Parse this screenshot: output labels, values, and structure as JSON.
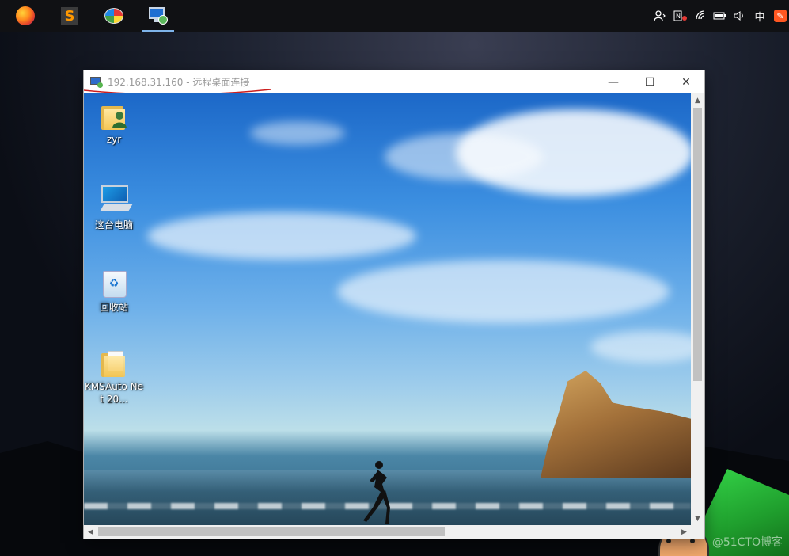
{
  "taskbar": {
    "apps": [
      {
        "name": "firefox-icon"
      },
      {
        "name": "sublime-text-icon"
      },
      {
        "name": "paint-icon"
      },
      {
        "name": "remote-desktop-icon",
        "active": true
      }
    ],
    "tray": {
      "ime_label": "中",
      "accent_color": "#7eb4ea"
    }
  },
  "window": {
    "title": "192.168.31.160 - 远程桌面连接",
    "buttons": {
      "minimize": "—",
      "maximize": "☐",
      "close": "✕"
    },
    "underline_color": "#cc1f1f"
  },
  "remote_desktop": {
    "icons": [
      {
        "label": "zyr",
        "icon": "user-folder-icon"
      },
      {
        "label": "这台电脑",
        "icon": "this-pc-icon"
      },
      {
        "label": "回收站",
        "icon": "recycle-bin-icon"
      },
      {
        "label": "KMSAuto Net 20...",
        "icon": "folder-icon"
      }
    ]
  },
  "scroll": {
    "up": "▲",
    "down": "▼",
    "left": "◀",
    "right": "▶"
  },
  "watermark": "@51CTO博客"
}
